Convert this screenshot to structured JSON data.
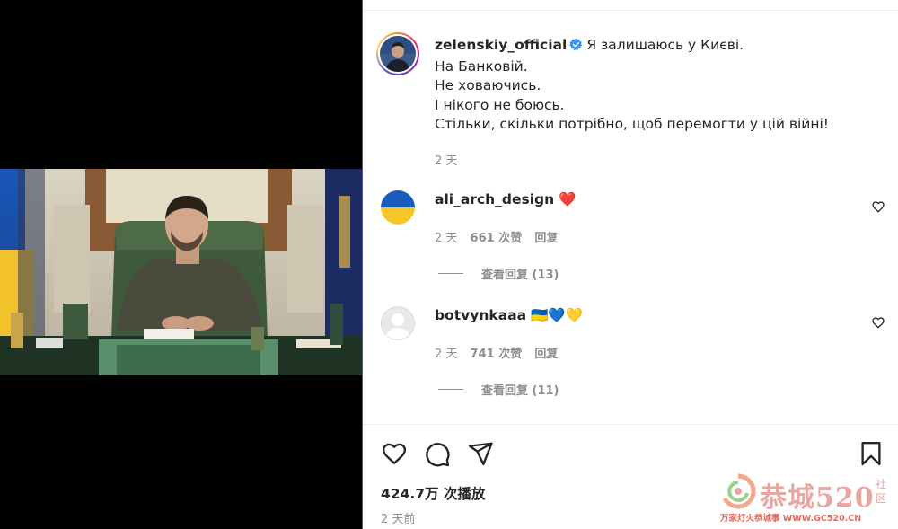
{
  "post": {
    "username": "zelenskiy_official",
    "caption_lines": [
      "Я залишаюсь у Києві.",
      "На Банковій.",
      "Не ховаючись.",
      "І нікого не боюсь.",
      "Стільки, скільки потрібно, щоб перемогти у цій війні!"
    ],
    "time": "2 天"
  },
  "comments": [
    {
      "username": "ali_arch_design",
      "text": "❤️",
      "time": "2 天",
      "likes": "661 次赞",
      "reply": "回复",
      "view_replies": "查看回复 (13)"
    },
    {
      "username": "botvynkaaa",
      "text": "🇺🇦💙💛",
      "time": "2 天",
      "likes": "741 次赞",
      "reply": "回复",
      "view_replies": "查看回复 (11)"
    }
  ],
  "footer": {
    "views": "424.7万 次播放",
    "posted": "2 天前"
  },
  "watermark": {
    "main": "恭城520",
    "side": "社区",
    "sub": "万家灯火恭城事 WWW.GC520.CN"
  },
  "icons": {
    "like": "heart-icon",
    "comment": "comment-icon",
    "share": "send-icon",
    "save": "bookmark-icon",
    "verified": "verified-badge-icon"
  },
  "colors": {
    "verified": "#3897f0",
    "comment_heart": "#ed4956",
    "muted_text": "#8e8e8e"
  }
}
